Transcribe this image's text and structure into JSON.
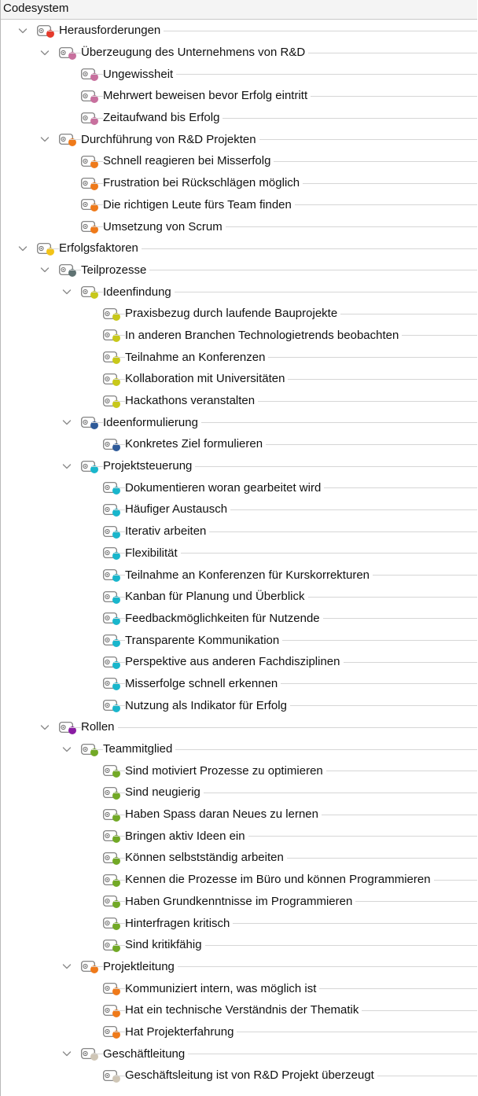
{
  "header": {
    "title": "Codesystem"
  },
  "colors": {
    "red": "#e53a2c",
    "pink": "#c8709e",
    "orange": "#ef7a1a",
    "yellow": "#f2c318",
    "teal": "#5f7272",
    "olive": "#c8c81a",
    "navy": "#2e5a99",
    "cyan": "#19b6cc",
    "purple": "#8a1ca3",
    "green": "#72a926",
    "beige": "#cfc6b6"
  },
  "tree": [
    {
      "label": "Herausforderungen",
      "level": 0,
      "expanded": true,
      "color": "red"
    },
    {
      "label": "Überzeugung des Unternehmens von R&D",
      "level": 1,
      "expanded": true,
      "color": "pink"
    },
    {
      "label": "Ungewissheit",
      "level": 2,
      "color": "pink"
    },
    {
      "label": "Mehrwert beweisen bevor Erfolg eintritt",
      "level": 2,
      "color": "pink"
    },
    {
      "label": "Zeitaufwand bis Erfolg",
      "level": 2,
      "color": "pink"
    },
    {
      "label": "Durchführung von R&D Projekten",
      "level": 1,
      "expanded": true,
      "color": "orange"
    },
    {
      "label": "Schnell reagieren bei Misserfolg",
      "level": 2,
      "color": "orange"
    },
    {
      "label": "Frustration bei Rückschlägen möglich",
      "level": 2,
      "color": "orange"
    },
    {
      "label": "Die richtigen Leute fürs Team finden",
      "level": 2,
      "color": "orange"
    },
    {
      "label": "Umsetzung von Scrum",
      "level": 2,
      "color": "orange"
    },
    {
      "label": "Erfolgsfaktoren",
      "level": 0,
      "expanded": true,
      "color": "yellow"
    },
    {
      "label": "Teilprozesse",
      "level": 1,
      "expanded": true,
      "color": "teal"
    },
    {
      "label": "Ideenfindung",
      "level": 2,
      "expanded": true,
      "color": "olive"
    },
    {
      "label": "Praxisbezug durch laufende Bauprojekte",
      "level": 3,
      "color": "olive"
    },
    {
      "label": "In anderen Branchen Technologietrends beobachten",
      "level": 3,
      "color": "olive"
    },
    {
      "label": "Teilnahme an Konferenzen",
      "level": 3,
      "color": "olive"
    },
    {
      "label": "Kollaboration mit Universitäten",
      "level": 3,
      "color": "olive"
    },
    {
      "label": "Hackathons veranstalten",
      "level": 3,
      "color": "olive"
    },
    {
      "label": "Ideenformulierung",
      "level": 2,
      "expanded": true,
      "color": "navy"
    },
    {
      "label": "Konkretes Ziel formulieren",
      "level": 3,
      "color": "navy"
    },
    {
      "label": "Projektsteuerung",
      "level": 2,
      "expanded": true,
      "color": "cyan"
    },
    {
      "label": "Dokumentieren woran gearbeitet wird",
      "level": 3,
      "color": "cyan"
    },
    {
      "label": "Häufiger Austausch",
      "level": 3,
      "color": "cyan"
    },
    {
      "label": "Iterativ arbeiten",
      "level": 3,
      "color": "cyan"
    },
    {
      "label": "Flexibilität",
      "level": 3,
      "color": "cyan"
    },
    {
      "label": "Teilnahme an Konferenzen für Kurskorrekturen",
      "level": 3,
      "color": "cyan"
    },
    {
      "label": "Kanban für Planung und Überblick",
      "level": 3,
      "color": "cyan"
    },
    {
      "label": "Feedbackmöglichkeiten für Nutzende",
      "level": 3,
      "color": "cyan"
    },
    {
      "label": "Transparente Kommunikation",
      "level": 3,
      "color": "cyan"
    },
    {
      "label": "Perspektive aus anderen Fachdisziplinen",
      "level": 3,
      "color": "cyan"
    },
    {
      "label": "Misserfolge schnell erkennen",
      "level": 3,
      "color": "cyan"
    },
    {
      "label": "Nutzung als Indikator für Erfolg",
      "level": 3,
      "color": "cyan"
    },
    {
      "label": "Rollen",
      "level": 1,
      "expanded": true,
      "color": "purple"
    },
    {
      "label": "Teammitglied",
      "level": 2,
      "expanded": true,
      "color": "green"
    },
    {
      "label": "Sind motiviert Prozesse zu optimieren",
      "level": 3,
      "color": "green"
    },
    {
      "label": "Sind neugierig",
      "level": 3,
      "color": "green"
    },
    {
      "label": "Haben Spass daran Neues zu lernen",
      "level": 3,
      "color": "green"
    },
    {
      "label": "Bringen aktiv Ideen ein",
      "level": 3,
      "color": "green"
    },
    {
      "label": "Können selbstständig arbeiten",
      "level": 3,
      "color": "green"
    },
    {
      "label": "Kennen die Prozesse im Büro und können Programmieren",
      "level": 3,
      "color": "green"
    },
    {
      "label": "Haben Grundkenntnisse im Programmieren",
      "level": 3,
      "color": "green"
    },
    {
      "label": "Hinterfragen kritisch",
      "level": 3,
      "color": "green"
    },
    {
      "label": "Sind kritikfähig",
      "level": 3,
      "color": "green"
    },
    {
      "label": "Projektleitung",
      "level": 2,
      "expanded": true,
      "color": "orange"
    },
    {
      "label": "Kommuniziert intern, was möglich ist",
      "level": 3,
      "color": "orange"
    },
    {
      "label": "Hat ein technische Verständnis der Thematik",
      "level": 3,
      "color": "orange"
    },
    {
      "label": "Hat Projekterfahrung",
      "level": 3,
      "color": "orange"
    },
    {
      "label": "Geschäftleitung",
      "level": 2,
      "expanded": true,
      "color": "beige"
    },
    {
      "label": "Geschäftsleitung ist von R&D Projekt überzeugt",
      "level": 3,
      "color": "beige"
    }
  ]
}
